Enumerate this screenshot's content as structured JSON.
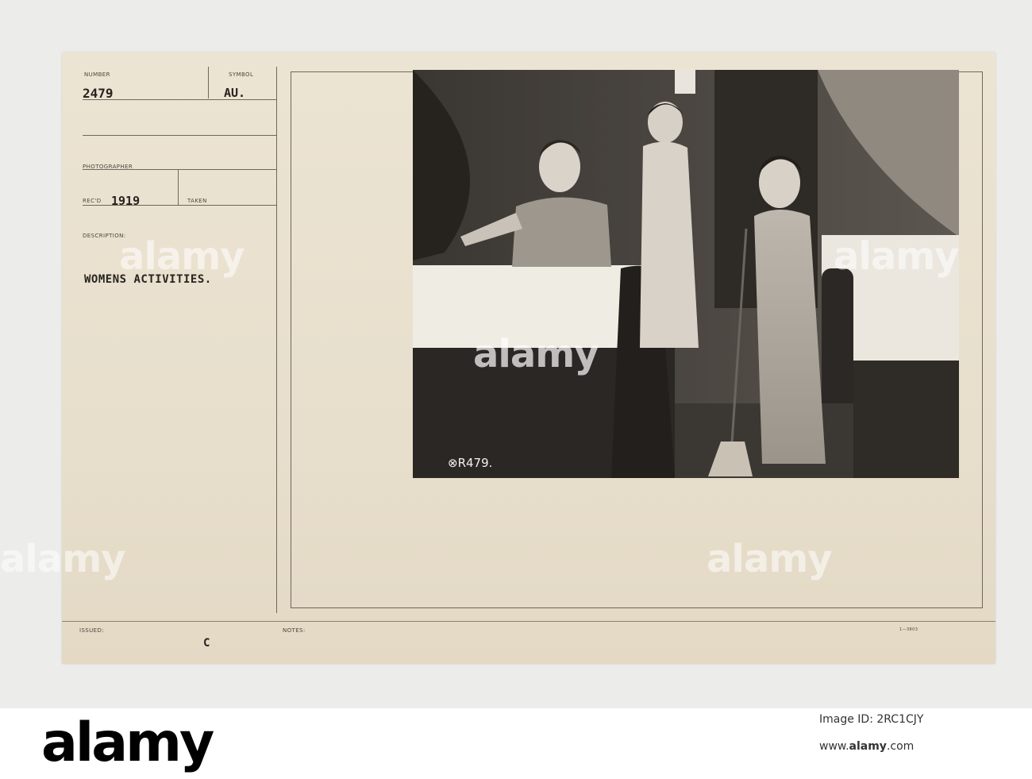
{
  "card": {
    "number_label": "NUMBER",
    "number_value": "2479",
    "symbol_label": "SYMBOL",
    "symbol_value": "AU.",
    "photographer_label": "PHOTOGRAPHER",
    "recd_label": "REC'D",
    "recd_value": "1919",
    "taken_label": "TAKEN",
    "description_label": "DESCRIPTION:",
    "description_value": "WOMENS ACTIVITIES.",
    "issued_label": "ISSUED:",
    "issued_mark": "C",
    "notes_label": "NOTES:",
    "form_code": "1—3803"
  },
  "photo": {
    "negative_number": "⊗R479."
  },
  "watermark": {
    "text": "alamy"
  },
  "footer": {
    "logo": "alamy",
    "image_id": "Image ID: 2RC1CJY",
    "url_prefix": "www.",
    "url_domain": "alamy",
    "url_suffix": ".com"
  },
  "colors": {
    "card_paper": "#e8dfcd",
    "ink": "#27231f",
    "photo_dark": "#2a2724",
    "photo_light": "#efece4"
  }
}
